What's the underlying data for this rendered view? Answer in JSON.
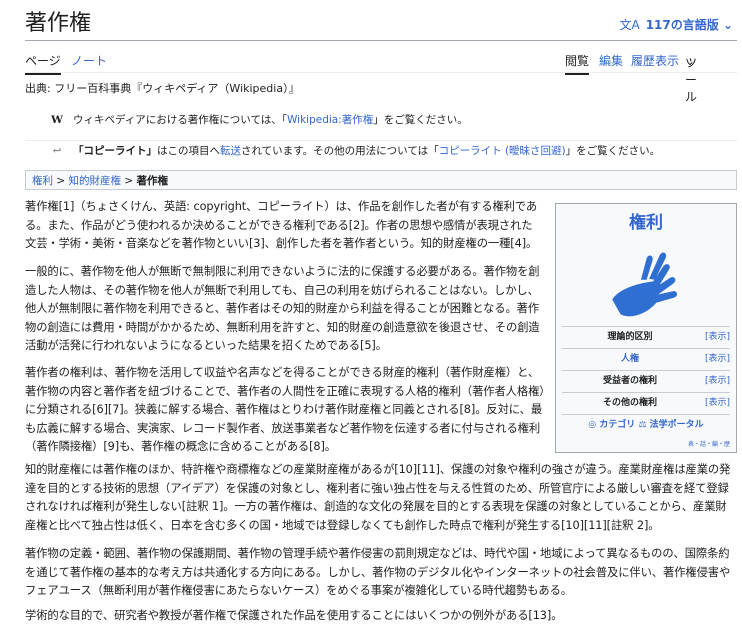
{
  "header": {
    "title": "著作権",
    "lang_label": "117の言語版"
  },
  "tabs": {
    "page": "ページ",
    "note": "ノート",
    "read": "閲覧",
    "edit": "編集",
    "history": "履歴表示",
    "tools": "ツール"
  },
  "source": "出典: フリー百科事典『ウィキペディア（Wikipedia）』",
  "hatnotes": {
    "h1_prefix": "ウィキペディアにおける著作権については、「",
    "h1_link": "Wikipedia:著作権",
    "h1_suffix": "」をご覧ください。",
    "h2_b": "「コピーライト」",
    "h2_mid": "はこの項目へ",
    "h2_link1": "転送",
    "h2_mid2": "されています。その他の用法については「",
    "h2_link2": "コピーライト (曖昧さ回避)",
    "h2_suffix": "」をご覧ください。"
  },
  "breadcrumb": {
    "item1": "権利",
    "item2": "知的財産権",
    "current": "著作権"
  },
  "infobox": {
    "title": "権利",
    "rows": [
      {
        "label": "理論的区別",
        "show": "[表示]"
      },
      {
        "label": "人権",
        "show": "[表示]"
      },
      {
        "label": "受益者の権利",
        "show": "[表示]"
      },
      {
        "label": "その他の権利",
        "show": "[表示]"
      }
    ],
    "portal_cat": "カテゴリ",
    "portal_law": "法学ポータル",
    "foot": "表・話・編・歴"
  },
  "article": {
    "p1": "著作権[1]（ちょさくけん、英語: copyright、コピーライト）は、作品を創作した者が有する権利である。また、作品がどう使われるか決めることができる権利である[2]。作者の思想や感情が表現された文芸・学術・美術・音楽などを著作物といい[3]、創作した者を著作者という。知的財産権の一種[4]。",
    "p2": "一般的に、著作物を他人が無断で無制限に利用できないように法的に保護する必要がある。著作物を創造した人物は、その著作物を他人が無断で利用しても、自己の利用を妨げられることはない。しかし、他人が無制限に著作物を利用できると、著作者はその知的財産から利益を得ることが困難となる。著作物の創造には費用・時間がかかるため、無断利用を許すと、知的財産の創造意欲を後退させ、その創造活動が活発に行われないようになるといった結果を招くためである[5]。",
    "p3": "著作者の権利は、著作物を活用して収益や名声などを得ることができる財産的権利（著作財産権）と、著作物の内容と著作者を紐づけることで、著作者の人間性を正確に表現する人格的権利（著作者人格権）に分類される[6][7]。狭義に解する場合、著作権はとりわけ著作財産権と同義とされる[8]。反対に、最も広義に解する場合、実演家、レコード製作者、放送事業者など著作物を伝達する者に付与される権利（著作隣接権）[9]も、著作権の概念に含めることがある[8]。",
    "p4": "知的財産権には著作権のほか、特許権や商標権などの産業財産権があるが[10][11]、保護の対象や権利の強さが違う。産業財産権は産業の発達を目的とする技術的思想（アイデア）を保護の対象とし、権利者に強い独占性を与える性質のため、所管官庁による厳しい審査を経て登録されなければ権利が発生しない[註釈 1]。一方の著作権は、創造的な文化の発展を目的とする表現を保護の対象としていることから、産業財産権と比べて独占性は低く、日本を含む多くの国・地域では登録しなくても創作した時点で権利が発生する[10][11][註釈 2]。",
    "p5": "著作物の定義・範囲、著作物の保護期間、著作物の管理手続や著作侵害の罰則規定などは、時代や国・地域によって異なるものの、国際条約を通じて著作権の基本的な考え方は共通化する方向にある。しかし、著作物のデジタル化やインターネットの社会普及に伴い、著作権侵害やフェアユース（無断利用が著作権侵害にあたらないケース）をめぐる事案が複雑化している時代趨勢もある。",
    "p6": "学術的な目的で、研究者や教授が著作権で保護された作品を使用することにはいくつかの例外がある[13]。"
  },
  "colors": {
    "link": "#3366cc",
    "text": "#202122",
    "border": "#a2a9b1"
  }
}
